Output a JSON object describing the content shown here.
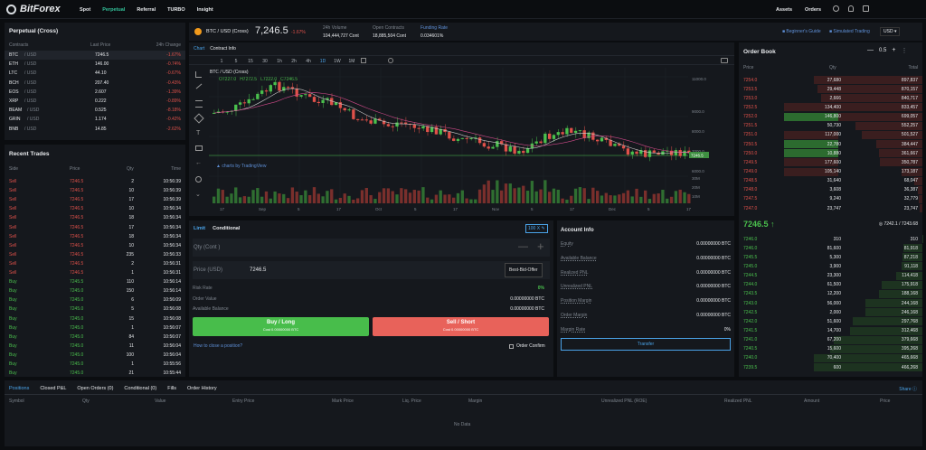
{
  "nav": {
    "logo": "BitForex",
    "items": [
      "Spot",
      "Perpetual",
      "Referral",
      "TURBO",
      "Insight"
    ],
    "right": [
      "Assets",
      "Orders"
    ]
  },
  "ticker": {
    "symbol": "BTC / USD (Cross)",
    "price": "7,246.5",
    "change": "-1.67%",
    "stats": [
      {
        "label": "24h Volume",
        "value": "104,444,727 Cont"
      },
      {
        "label": "Open Contracts",
        "value": "18,885,504 Cont"
      },
      {
        "label": "Funding Rate",
        "value": "0.034601%"
      }
    ],
    "links": [
      "Beginner's Guide",
      "Simulated Trading"
    ],
    "currency": "USD"
  },
  "markets": {
    "title": "Perpetual (Cross)",
    "headers": [
      "Contracts",
      "Last Price",
      "24h Change"
    ],
    "rows": [
      {
        "sym": "BTC",
        "q": "/ USD",
        "price": "7246.5",
        "chg": "-1.67%"
      },
      {
        "sym": "ETH",
        "q": "/ USD",
        "price": "146.00",
        "chg": "-0.74%"
      },
      {
        "sym": "LTC",
        "q": "/ USD",
        "price": "44.10",
        "chg": "-0.67%"
      },
      {
        "sym": "BCH",
        "q": "/ USD",
        "price": "207.40",
        "chg": "-0.43%"
      },
      {
        "sym": "EOS",
        "q": "/ USD",
        "price": "2.607",
        "chg": "-1.39%"
      },
      {
        "sym": "XRP",
        "q": "/ USD",
        "price": "0.222",
        "chg": "-0.89%"
      },
      {
        "sym": "BEAM",
        "q": "/ USD",
        "price": "0.525",
        "chg": "-8.18%"
      },
      {
        "sym": "GRIN",
        "q": "/ USD",
        "price": "1.174",
        "chg": "-0.42%"
      },
      {
        "sym": "BNB",
        "q": "/ USD",
        "price": "14.85",
        "chg": "-2.62%"
      }
    ]
  },
  "trades": {
    "title": "Recent Trades",
    "headers": [
      "Side",
      "Price",
      "Qty",
      "Time"
    ],
    "rows": [
      [
        "Sell",
        "7246.5",
        "2",
        "10:56:39"
      ],
      [
        "Sell",
        "7246.5",
        "10",
        "10:56:39"
      ],
      [
        "Sell",
        "7246.5",
        "17",
        "10:56:39"
      ],
      [
        "Sell",
        "7246.5",
        "10",
        "10:56:34"
      ],
      [
        "Sell",
        "7246.5",
        "18",
        "10:56:34"
      ],
      [
        "Sell",
        "7246.5",
        "17",
        "10:56:34"
      ],
      [
        "Sell",
        "7246.5",
        "18",
        "10:56:34"
      ],
      [
        "Sell",
        "7246.5",
        "10",
        "10:56:34"
      ],
      [
        "Sell",
        "7246.5",
        "235",
        "10:56:33"
      ],
      [
        "Sell",
        "7246.5",
        "2",
        "10:56:31"
      ],
      [
        "Sell",
        "7246.5",
        "1",
        "10:56:31"
      ],
      [
        "Buy",
        "7245.5",
        "110",
        "10:56:14"
      ],
      [
        "Buy",
        "7245.0",
        "150",
        "10:56:14"
      ],
      [
        "Buy",
        "7245.0",
        "6",
        "10:56:09"
      ],
      [
        "Buy",
        "7245.0",
        "5",
        "10:56:08"
      ],
      [
        "Buy",
        "7245.0",
        "15",
        "10:56:08"
      ],
      [
        "Buy",
        "7245.0",
        "1",
        "10:56:07"
      ],
      [
        "Buy",
        "7245.0",
        "84",
        "10:56:07"
      ],
      [
        "Buy",
        "7245.0",
        "11",
        "10:56:04"
      ],
      [
        "Buy",
        "7245.0",
        "100",
        "10:56:04"
      ],
      [
        "Buy",
        "7245.0",
        "1",
        "10:55:56"
      ],
      [
        "Buy",
        "7245.0",
        "21",
        "10:55:44"
      ]
    ]
  },
  "chart": {
    "tabs": [
      "Chart",
      "Contract Info"
    ],
    "intervals": [
      "1",
      "5",
      "15",
      "30",
      "1h",
      "2h",
      "4h",
      "1D",
      "1W",
      "1M"
    ],
    "pair": "BTC / USD (Cross)",
    "ohlc": {
      "o": "O7227.0",
      "h": "H7272.5",
      "l": "L7222.0",
      "c": "C7246.5"
    },
    "watermark": "charts by TradingView",
    "price_ticks": [
      "11000.0",
      "9000.0",
      "8000.0",
      "7000.0",
      "6000.0"
    ],
    "last_tag": "7246.5",
    "vol_ticks": [
      "30M",
      "20M",
      "10M"
    ],
    "x_ticks": [
      "17",
      "Sep",
      "5",
      "17",
      "Oct",
      "5",
      "17",
      "Nov",
      "5",
      "17",
      "Dec",
      "5",
      "17"
    ]
  },
  "order": {
    "tabs": [
      "Limit",
      "Conditional"
    ],
    "leverage": "100 X",
    "qty_label": "Qty (Cont )",
    "price_label": "Price (USD)",
    "price_value": "7246.5",
    "bbo": "Best-Bid-Offer",
    "risk_label": "Risk Rate",
    "risk_value": "0%",
    "ov_label": "Order Value",
    "ov_value": "0.00000000 BTC",
    "ab_label": "Available Balance",
    "ab_value": "0.00000000 BTC",
    "buy": "Buy / Long",
    "buy_cost": "Cost 0.00000000 BTC",
    "sell": "Sell / Short",
    "sell_cost": "Cost 0.00000000 BTC",
    "howto": "How to close a position?",
    "confirm": "Order Confirm"
  },
  "account": {
    "title": "Account Info",
    "rows": [
      {
        "k": "Equity",
        "v": "0.00000000 BTC"
      },
      {
        "k": "Available Balance",
        "v": "0.00000000 BTC"
      },
      {
        "k": "Realized PNL",
        "v": "0.00000000 BTC"
      },
      {
        "k": "Unrealized PNL",
        "v": "0.00000000 BTC"
      },
      {
        "k": "Position Margin",
        "v": "0.00000000 BTC"
      },
      {
        "k": "Order Margin",
        "v": "0.00000000 BTC"
      },
      {
        "k": "Margin Rate",
        "v": "0%"
      }
    ],
    "transfer": "Transfer"
  },
  "book": {
    "title": "Order Book",
    "step": "0.5",
    "headers": [
      "Price",
      "Qty",
      "Total"
    ],
    "asks": [
      [
        "7254.0",
        "27,680",
        "897,837"
      ],
      [
        "7253.5",
        "29,448",
        "870,157"
      ],
      [
        "7253.0",
        "2,666",
        "840,717"
      ],
      [
        "7252.5",
        "134,400",
        "833,457"
      ],
      [
        "7252.0",
        "146,800",
        "699,057"
      ],
      [
        "7251.5",
        "50,730",
        "552,257"
      ],
      [
        "7251.0",
        "117,000",
        "501,527"
      ],
      [
        "7250.5",
        "22,780",
        "384,447"
      ],
      [
        "7250.0",
        "10,880",
        "361,667"
      ],
      [
        "7249.5",
        "177,600",
        "350,787"
      ],
      [
        "7249.0",
        "105,140",
        "173,187"
      ],
      [
        "7248.5",
        "31,640",
        "68,047"
      ],
      [
        "7248.0",
        "3,608",
        "36,387"
      ],
      [
        "7247.5",
        "9,240",
        "32,779"
      ],
      [
        "7247.0",
        "23,747",
        "23,747"
      ]
    ],
    "last": "7246.5",
    "mark": "7242.1 / 7243.68",
    "bids": [
      [
        "7246.0",
        "310",
        "310"
      ],
      [
        "7246.0",
        "81,600",
        "81,918"
      ],
      [
        "7245.5",
        "5,300",
        "87,218"
      ],
      [
        "7245.0",
        "3,900",
        "91,118"
      ],
      [
        "7244.5",
        "23,300",
        "114,418"
      ],
      [
        "7244.0",
        "61,500",
        "175,918"
      ],
      [
        "7243.5",
        "12,200",
        "188,168"
      ],
      [
        "7243.0",
        "56,000",
        "244,168"
      ],
      [
        "7242.5",
        "2,000",
        "246,168"
      ],
      [
        "7242.0",
        "51,600",
        "297,768"
      ],
      [
        "7241.5",
        "14,700",
        "312,468"
      ],
      [
        "7241.0",
        "67,200",
        "379,668"
      ],
      [
        "7240.5",
        "15,600",
        "395,268"
      ],
      [
        "7240.0",
        "70,400",
        "465,668"
      ],
      [
        "7239.5",
        "600",
        "466,268"
      ]
    ]
  },
  "bottom": {
    "tabs": [
      "Positions",
      "Closed P&L",
      "Open Orders (0)",
      "Conditional (0)",
      "Fills",
      "Order History"
    ],
    "share": "Share",
    "cols": [
      "Symbol",
      "Qty",
      "Value",
      "Entry Price",
      "Mark Price",
      "Liq. Price",
      "Margin",
      "Unrealized PNL (ROE)",
      "Realized PNL",
      "Amount",
      "Price"
    ],
    "empty": "No Data"
  }
}
